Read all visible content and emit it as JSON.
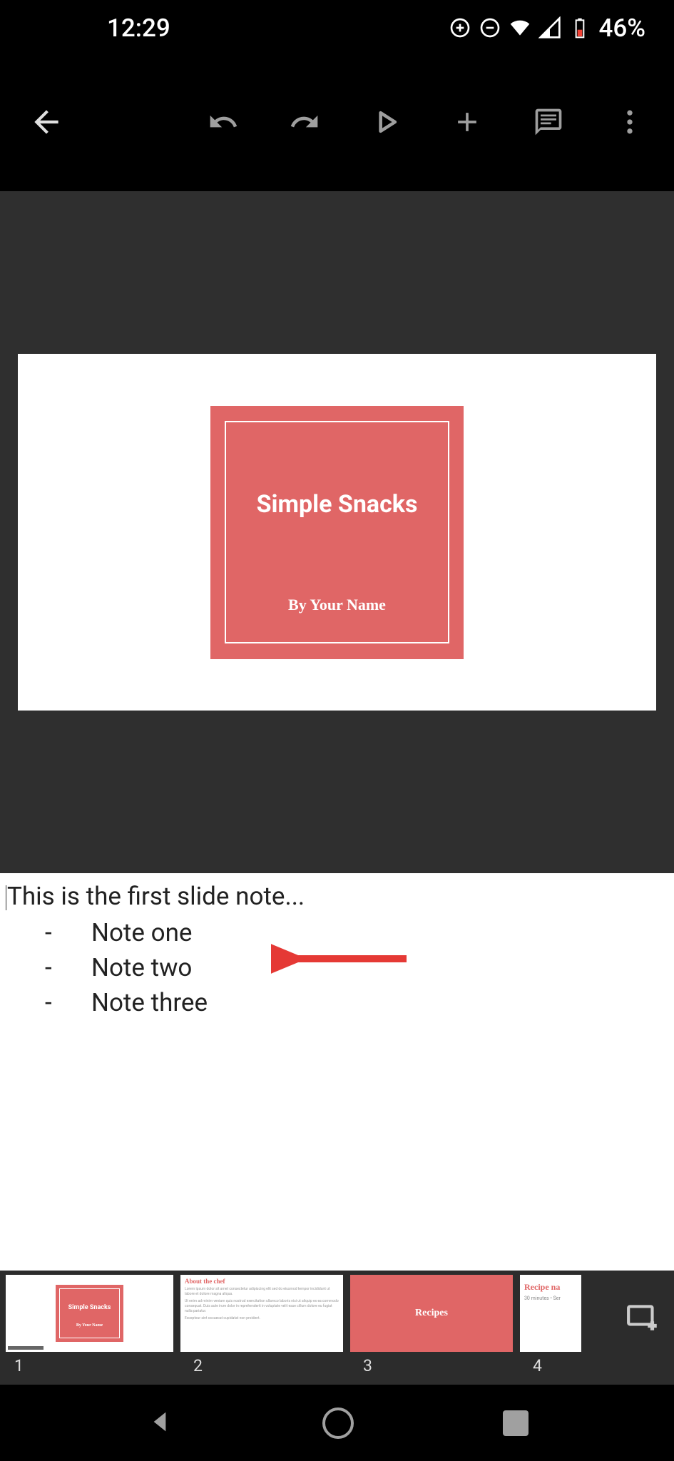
{
  "status": {
    "time": "12:29",
    "battery": "46%"
  },
  "slide": {
    "title": "Simple Snacks",
    "author": "By Your Name"
  },
  "notes": {
    "header": "This is the first slide note...",
    "items": [
      "Note one",
      "Note two",
      "Note three"
    ]
  },
  "thumbnails": [
    {
      "number": "1",
      "title": "Simple Snacks",
      "author": "By Your Name"
    },
    {
      "number": "2",
      "header": "About the chef"
    },
    {
      "number": "3",
      "label": "Recipes"
    },
    {
      "number": "4",
      "header": "Recipe na",
      "sub": "30 minutes • Ser"
    }
  ]
}
